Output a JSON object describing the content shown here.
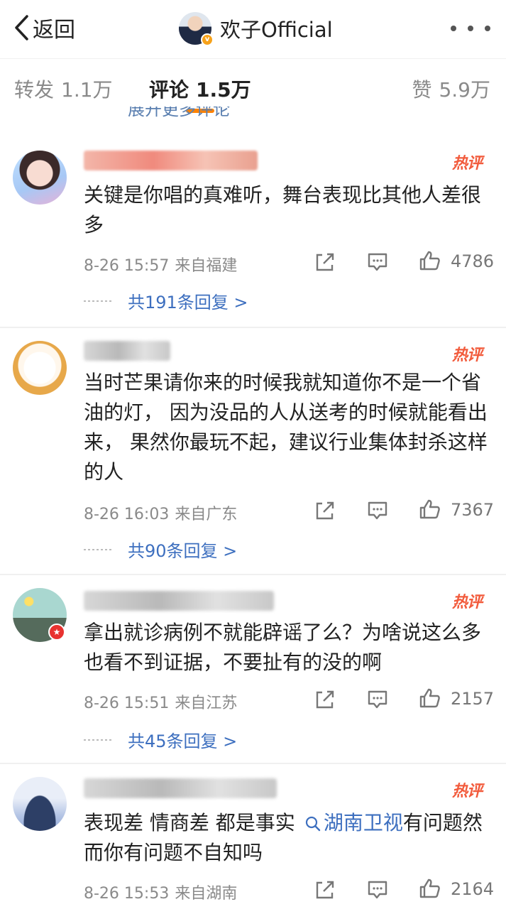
{
  "header": {
    "back_label": "返回",
    "account_name": "欢子Official",
    "back_icon": "chevron-left-icon",
    "more_icon": "more-dots-icon",
    "badge_icon": "verified-v-icon"
  },
  "tabs": {
    "repost_label": "转发",
    "repost_count": "1.1万",
    "comment_label": "评论",
    "comment_count": "1.5万",
    "like_label": "赞",
    "like_count": "5.9万",
    "accent_color": "#ff8200"
  },
  "peek_text": "展开更多评论",
  "hot_label": "热评",
  "comments": [
    {
      "text": "关键是你唱的真难听，舞台表现比其他人差很多",
      "time": "8-26 15:57",
      "location": "来自福建",
      "likes": "4786",
      "replies": "共191条回复 >"
    },
    {
      "text": "当时芒果请你来的时候我就知道你不是一个省油的灯， 因为没品的人从送考的时候就能看出来， 果然你最玩不起，建议行业集体封杀这样的人",
      "time": "8-26 16:03",
      "location": "来自广东",
      "likes": "7367",
      "replies": "共90条回复 >"
    },
    {
      "text": "拿出就诊病例不就能辟谣了么？为啥说这么多也看不到证据，不要扯有的没的啊",
      "time": "8-26 15:51",
      "location": "来自江苏",
      "likes": "2157",
      "replies": "共45条回复 >"
    },
    {
      "text_before": "表现差 情商差  都是事实",
      "topic": "湖南卫视",
      "text_after": "有问题然而你有问题不自知吗",
      "time": "8-26 15:53",
      "location": "来自湖南",
      "likes": "2164"
    }
  ],
  "colors": {
    "link_blue": "#3d6fbf",
    "hot_red": "#f25b3c",
    "meta_gray": "#8a8a8a"
  }
}
